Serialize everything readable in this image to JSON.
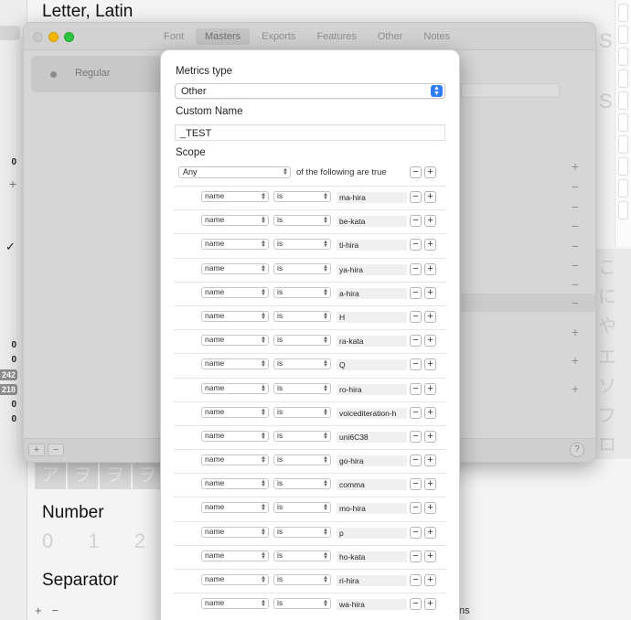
{
  "background": {
    "title": "Letter, Latin",
    "left_numbers": [
      "0",
      "0",
      "0",
      "242",
      "218",
      "0",
      "0"
    ],
    "sections": [
      "Number",
      "Separator"
    ],
    "number_digits": "0 1 2 3",
    "glyph_row": [
      "ア",
      "ヲ",
      "ヲ",
      "ヲ"
    ],
    "right_glyphs": [
      "こ",
      "に",
      "や",
      "エ",
      "ソ",
      "フ",
      "ロ"
    ],
    "right_letters": [
      "S",
      "S"
    ],
    "bottom_plus": "+",
    "bottom_minus": "−",
    "fragment_text": "ns"
  },
  "window": {
    "tabs": [
      "Font",
      "Masters",
      "Exports",
      "Features",
      "Other",
      "Notes"
    ],
    "active_tab": "Masters",
    "master_name": "Regular",
    "footer_add": "+",
    "footer_remove": "−",
    "help": "?"
  },
  "popover": {
    "metrics_type_label": "Metrics type",
    "metrics_type_value": "Other",
    "custom_name_label": "Custom Name",
    "custom_name_value": "_TEST",
    "scope_label": "Scope",
    "scope_match": "Any",
    "scope_suffix": "of the following are true",
    "rules": [
      {
        "field": "name",
        "op": "is",
        "value": "ma-hira"
      },
      {
        "field": "name",
        "op": "is",
        "value": "be-kata"
      },
      {
        "field": "name",
        "op": "is",
        "value": "ti-hira"
      },
      {
        "field": "name",
        "op": "is",
        "value": "ya-hira"
      },
      {
        "field": "name",
        "op": "is",
        "value": "a-hira"
      },
      {
        "field": "name",
        "op": "is",
        "value": "H"
      },
      {
        "field": "name",
        "op": "is",
        "value": "ra-kata"
      },
      {
        "field": "name",
        "op": "is",
        "value": "Q"
      },
      {
        "field": "name",
        "op": "is",
        "value": "ro-hira"
      },
      {
        "field": "name",
        "op": "is",
        "value": "voicediteration-h"
      },
      {
        "field": "name",
        "op": "is",
        "value": "uni6C38"
      },
      {
        "field": "name",
        "op": "is",
        "value": "go-hira"
      },
      {
        "field": "name",
        "op": "is",
        "value": "comma"
      },
      {
        "field": "name",
        "op": "is",
        "value": "mo-hira"
      },
      {
        "field": "name",
        "op": "is",
        "value": "p"
      },
      {
        "field": "name",
        "op": "is",
        "value": "ho-kata"
      },
      {
        "field": "name",
        "op": "is",
        "value": "ri-hira"
      },
      {
        "field": "name",
        "op": "is",
        "value": "wa-hira"
      }
    ]
  },
  "colors": {
    "accent": "#2d7ef7",
    "traffic_yellow": "#f2b500",
    "traffic_green": "#2ec340"
  }
}
